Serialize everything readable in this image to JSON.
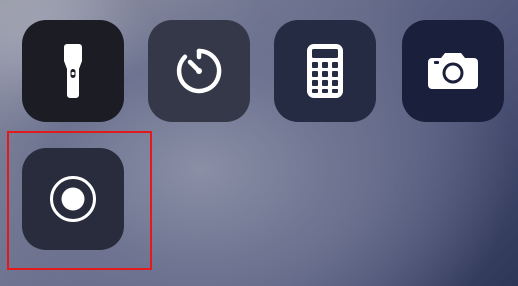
{
  "controls": [
    {
      "id": "flashlight",
      "icon": "flashlight-icon"
    },
    {
      "id": "timer",
      "icon": "timer-icon"
    },
    {
      "id": "calculator",
      "icon": "calculator-icon"
    },
    {
      "id": "camera",
      "icon": "camera-icon"
    },
    {
      "id": "screen-recording",
      "icon": "record-icon"
    }
  ],
  "highlight": {
    "target": "screen-recording",
    "color": "#e31a1c"
  }
}
